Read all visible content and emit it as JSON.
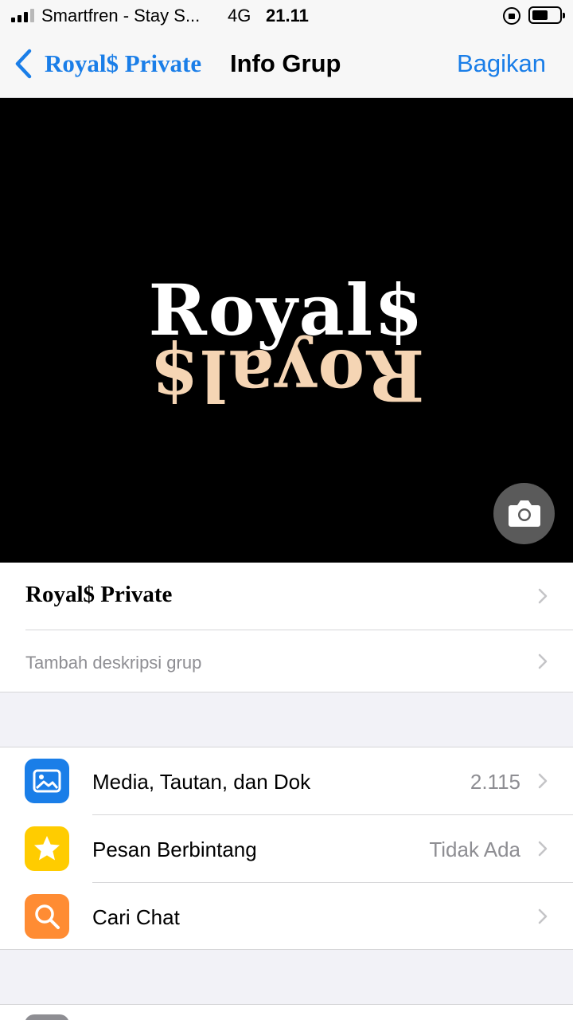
{
  "status_bar": {
    "carrier": "Smartfren - Stay S...",
    "network": "4G",
    "time": "21.11"
  },
  "nav": {
    "back_label": "Royal$ Private",
    "title": "Info Grup",
    "share_label": "Bagikan"
  },
  "group_photo": {
    "logo_top": "Royal$",
    "logo_bottom": "Royal$"
  },
  "group": {
    "name": "Royal$ Private",
    "description_placeholder": "Tambah deskripsi grup"
  },
  "menu": {
    "items": [
      {
        "label": "Media, Tautan, dan Dok",
        "value": "2.115",
        "icon": "photo-icon",
        "color": "#1a7ee8"
      },
      {
        "label": "Pesan Berbintang",
        "value": "Tidak Ada",
        "icon": "star-icon",
        "color": "#ffcc00"
      },
      {
        "label": "Cari Chat",
        "value": "",
        "icon": "search-icon",
        "color": "#ff8c33"
      }
    ]
  },
  "colors": {
    "accent": "#1a7ee8",
    "secondary_text": "#8e8e93",
    "background": "#f2f2f7"
  }
}
